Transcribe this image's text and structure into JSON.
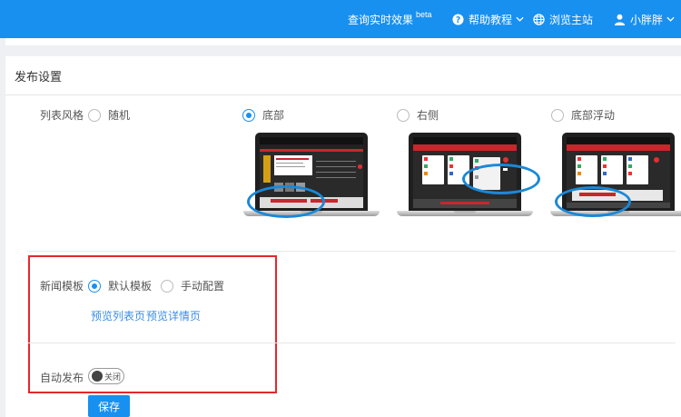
{
  "topbar": {
    "realtime_label": "查询实时效果",
    "beta_label": "beta",
    "help_label": "帮助教程",
    "site_label": "浏览主站",
    "user_label": "小胖胖"
  },
  "panel": {
    "title": "发布设置"
  },
  "list_style": {
    "label": "列表风格",
    "options": [
      "随机",
      "底部",
      "右侧",
      "底部浮动"
    ],
    "selected": "底部"
  },
  "news_template": {
    "label": "新闻模板",
    "options": [
      "默认模板",
      "手动配置"
    ],
    "selected": "默认模板",
    "preview_list_link": "预览列表页",
    "preview_detail_link": "预览详情页"
  },
  "auto_publish": {
    "label": "自动发布",
    "toggle_label": "关闭",
    "enabled": false
  },
  "save_button": "保存",
  "colors": {
    "primary": "#1890f0",
    "highlight_box": "#e5272d",
    "annotation_ellipse": "#1a88d8"
  }
}
